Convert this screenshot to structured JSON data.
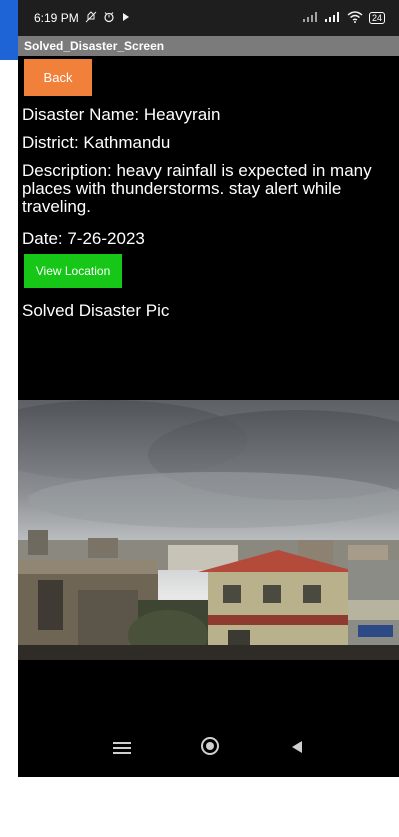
{
  "status_bar": {
    "time": "6:19 PM",
    "icons_left": [
      "notification-muted-icon",
      "alarm-icon",
      "cast-icon"
    ],
    "icons_right": [
      "signal-icon",
      "signal-icon",
      "wifi-icon"
    ],
    "battery": "24"
  },
  "app": {
    "screen_title": "Solved_Disaster_Screen"
  },
  "buttons": {
    "back_label": "Back",
    "view_location_label": "View Location"
  },
  "disaster": {
    "name_line": "Disaster Name: Heavyrain",
    "district_line": "District: Kathmandu",
    "description_line": "Description: heavy rainfall is expected in many places with thunderstorms. stay alert while traveling.",
    "date_line": "Date: 7-26-2023",
    "pic_label": "Solved Disaster Pic"
  },
  "colors": {
    "back_button": "#f0803a",
    "view_location_button": "#17c717",
    "title_bar": "#7b7b7b"
  }
}
